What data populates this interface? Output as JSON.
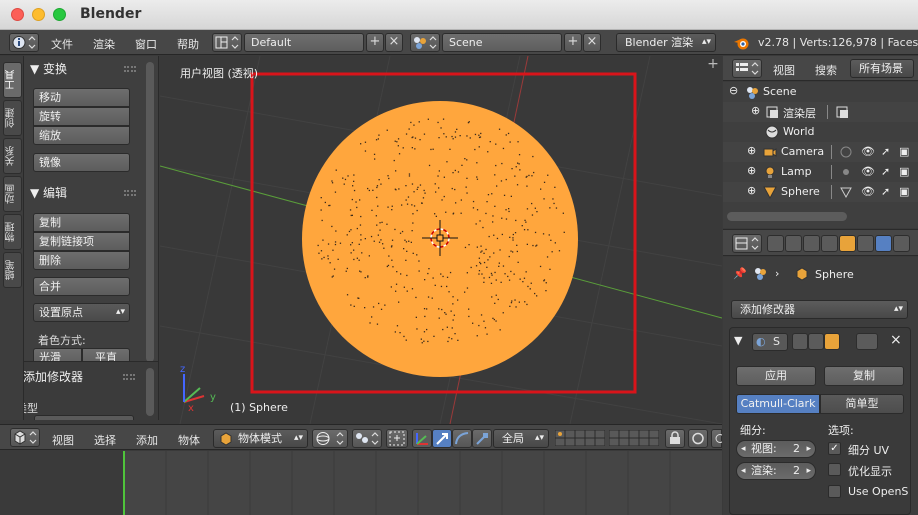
{
  "window": {
    "title": "Blender"
  },
  "info_header": {
    "menus": [
      "文件",
      "渲染",
      "窗口",
      "帮助"
    ],
    "screen_layout": "Default",
    "scene": "Scene",
    "render_engine": "Blender 渲染",
    "stats": "v2.78 | Verts:126,978 | Faces:"
  },
  "tool_tabs": [
    "工具",
    "创建",
    "关系",
    "动画",
    "物理",
    "蜡笔"
  ],
  "tool_shelf": {
    "transform_header": "▼ 变换",
    "transform_buttons": [
      "移动",
      "旋转",
      "缩放"
    ],
    "mirror_button": "镜像",
    "edit_header": "▼ 编辑",
    "edit_buttons": [
      "复制",
      "复制链接项",
      "删除"
    ],
    "join_button": "合并",
    "set_origin": "设置原点",
    "shading_label": "着色方式:",
    "shading_buttons": [
      "光滑",
      "平直"
    ]
  },
  "operator_panel": {
    "header": "▼ 添加修改器",
    "type_label": "类型"
  },
  "viewport": {
    "title": "用户视图 (透视)",
    "object_label": "(1) Sphere",
    "sphere_color": "#ffa63d",
    "highlight_color": "#d9141a"
  },
  "view_header": {
    "menus": [
      "视图",
      "选择",
      "添加",
      "物体"
    ],
    "mode": "物体模式",
    "pivot_space": "全局"
  },
  "outliner": {
    "header_items": [
      "视图",
      "搜索",
      "所有场景"
    ],
    "rows": [
      {
        "label": "Scene",
        "icon": "scene-icon"
      },
      {
        "label": "渲染层",
        "icon": "render-layer-icon"
      },
      {
        "label": "World",
        "icon": "world-icon"
      },
      {
        "label": "Camera",
        "icon": "camera-icon"
      },
      {
        "label": "Lamp",
        "icon": "lamp-icon"
      },
      {
        "label": "Sphere",
        "icon": "mesh-icon"
      }
    ]
  },
  "properties": {
    "context_object": "Sphere",
    "add_modifier": "添加修改器",
    "modifier_short": "S",
    "apply": "应用",
    "copy": "复制",
    "subdiv_type": [
      "Catmull-Clark",
      "简单型"
    ],
    "subdivisions_label": "细分:",
    "view_field": "视图:",
    "view_value": "2",
    "render_field": "渲染:",
    "render_value": "2",
    "options_label": "选项:",
    "options": [
      {
        "label": "细分 UV",
        "checked": true
      },
      {
        "label": "优化显示",
        "checked": false
      },
      {
        "label": "Use OpenS",
        "checked": false
      }
    ]
  },
  "colors": {
    "accent_blue": "#5680c2",
    "selection_orange": "#ffa63d"
  }
}
